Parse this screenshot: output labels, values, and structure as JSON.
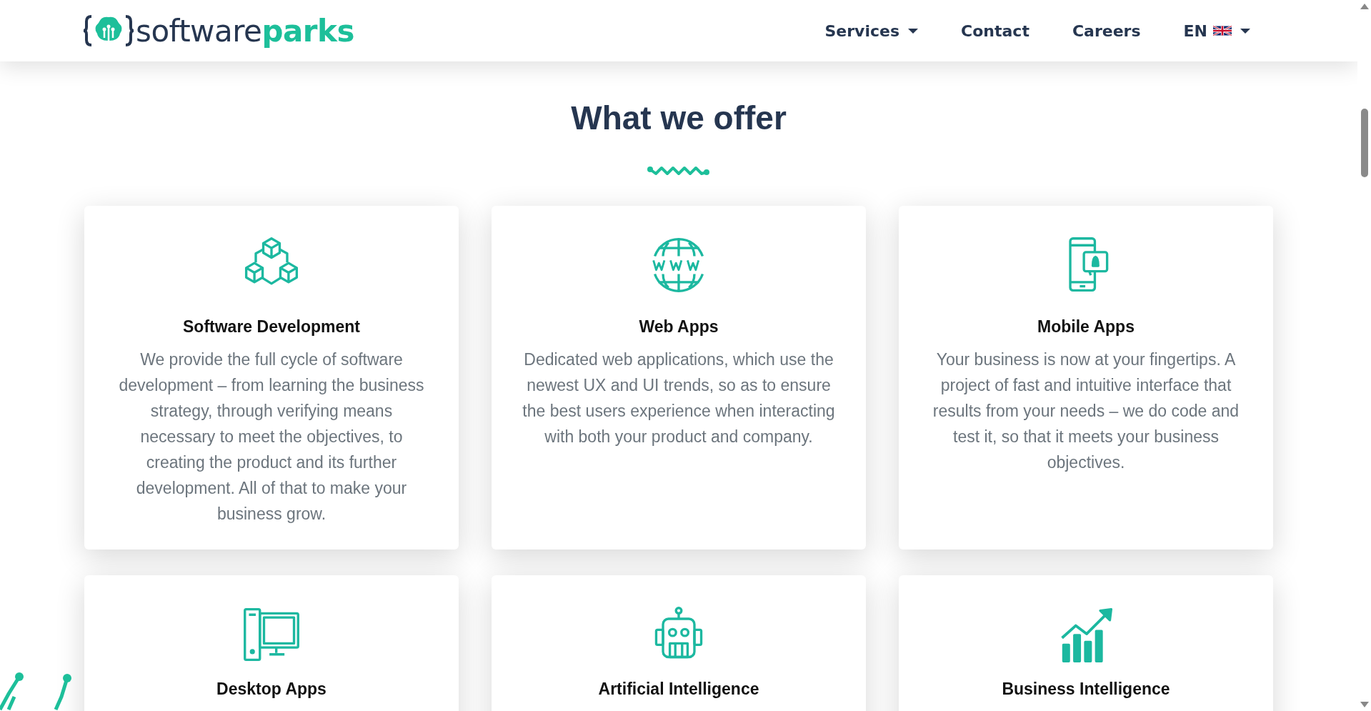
{
  "header": {
    "logo": {
      "part_1": "software",
      "part_2": "parks"
    },
    "nav": [
      {
        "label": "Services",
        "kind": "dropdown"
      },
      {
        "label": "Contact",
        "kind": "link"
      },
      {
        "label": "Careers",
        "kind": "link"
      },
      {
        "label": "EN",
        "kind": "language"
      }
    ]
  },
  "section": {
    "title": "What we offer",
    "cards": [
      {
        "kind": "cubes",
        "title": "Software Development",
        "text": "We provide the full cycle of software development – from learning the business strategy, through verifying means necessary to meet the objectives, to creating the product and its further development. All of that to make your business grow."
      },
      {
        "kind": "globe",
        "title": "Web Apps",
        "text": "Dedicated web applications, which use the newest UX and UI trends, so as to ensure the best users experience when interacting with both your product and company."
      },
      {
        "kind": "phone",
        "title": "Mobile Apps",
        "text": "Your business is now at your fingertips. A project of fast and intuitive interface that results from your needs – we do code and test it, so that it meets your business objectives."
      },
      {
        "kind": "desktop",
        "title": "Desktop Apps"
      },
      {
        "kind": "robot",
        "title": "Artificial Intelligence"
      },
      {
        "kind": "chart",
        "title": "Business Intelligence"
      }
    ]
  }
}
